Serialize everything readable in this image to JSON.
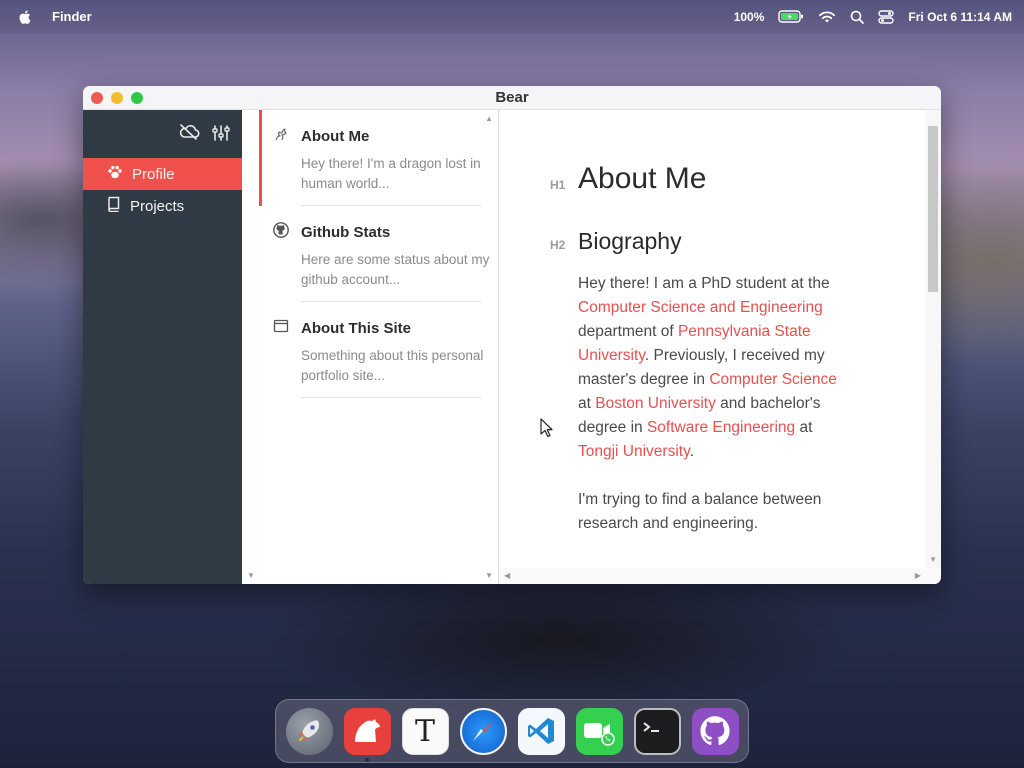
{
  "menubar": {
    "app_name": "Finder",
    "battery": "100%",
    "datetime": "Fri Oct 6  11:14 AM",
    "icons": [
      "apple-icon",
      "battery-icon",
      "wifi-icon",
      "search-icon",
      "control-center-icon"
    ]
  },
  "window": {
    "title": "Bear",
    "sidebar": {
      "tool_icons": [
        "cloud-off-icon",
        "sliders-icon"
      ],
      "items": [
        {
          "label": "Profile",
          "icon": "paw-icon",
          "active": true
        },
        {
          "label": "Projects",
          "icon": "book-icon",
          "active": false
        }
      ]
    },
    "notes": [
      {
        "title": "About Me",
        "snippet": "Hey there! I'm a dragon lost in human world...",
        "icon": "dragon-icon",
        "selected": true
      },
      {
        "title": "Github Stats",
        "snippet": "Here are some status about my github account...",
        "icon": "github-icon",
        "selected": false
      },
      {
        "title": "About This Site",
        "snippet": "Something about this personal portfolio site...",
        "icon": "browser-window-icon",
        "selected": false
      }
    ],
    "editor": {
      "h1_marker": "H1",
      "h1": "About Me",
      "h2_marker": "H2",
      "h2": "Biography",
      "p1": {
        "t1": "Hey there! I am a PhD student at the ",
        "l1": "Computer Science and Engineering",
        "t2": " department of ",
        "l2": "Pennsylvania State University",
        "t3": ". Previously, I received my master's degree in ",
        "l3": "Computer Science",
        "t4": " at ",
        "l4": "Boston University",
        "t5": " and bachelor's degree in ",
        "l5": "Software Engineering",
        "t6": " at ",
        "l6": "Tongji University",
        "t7": "."
      },
      "p2": "I'm trying to find a balance between research and engineering."
    }
  },
  "dock": {
    "apps": [
      {
        "name": "launchpad-icon",
        "running": false
      },
      {
        "name": "bear-icon",
        "running": true
      },
      {
        "name": "typora-icon",
        "glyph": "T",
        "running": false
      },
      {
        "name": "safari-icon",
        "running": false
      },
      {
        "name": "vscode-icon",
        "running": false
      },
      {
        "name": "facetime-icon",
        "running": false
      },
      {
        "name": "terminal-icon",
        "running": false
      },
      {
        "name": "github-icon",
        "running": false
      }
    ]
  },
  "colors": {
    "accent": "#f0514d",
    "link": "#e6504f",
    "sidebar_bg": "#2f3a44"
  }
}
